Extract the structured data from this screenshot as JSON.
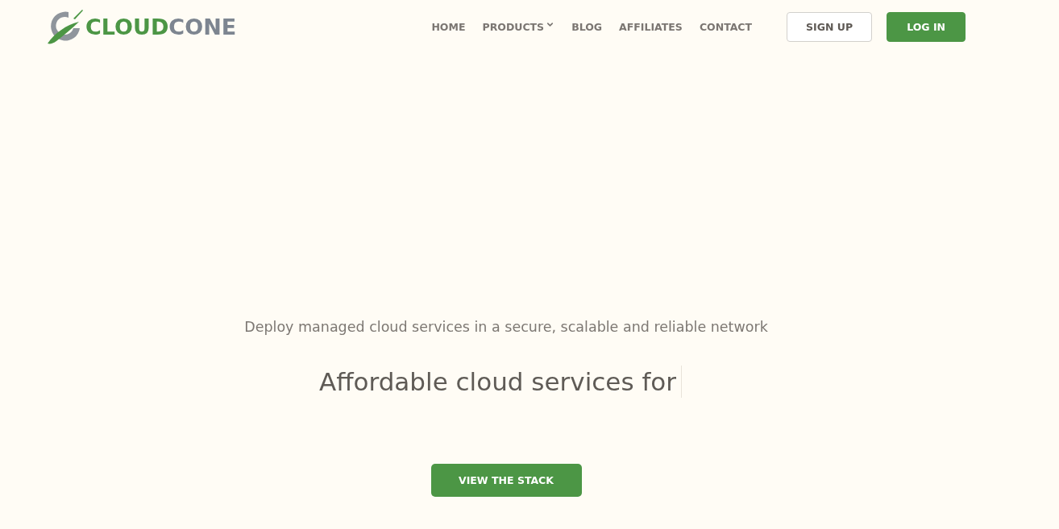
{
  "logo": {
    "lead": "CLOUD",
    "tail": "CONE"
  },
  "nav": {
    "items": [
      {
        "label": "HOME",
        "kind": "link"
      },
      {
        "label": "PRODUCTS",
        "kind": "dropdown"
      },
      {
        "label": "BLOG",
        "kind": "link"
      },
      {
        "label": "AFFILIATES",
        "kind": "link"
      },
      {
        "label": "CONTACT",
        "kind": "link"
      }
    ]
  },
  "auth_buttons": [
    {
      "label": "SIGN UP",
      "kind": "outline"
    },
    {
      "label": "LOG IN",
      "kind": "primary"
    }
  ],
  "hero": {
    "subtitle": "Deploy managed cloud services in a secure, scalable and reliable network",
    "headline": "Affordable cloud services for",
    "typing_cursor": true,
    "cta": "VIEW THE STACK"
  }
}
